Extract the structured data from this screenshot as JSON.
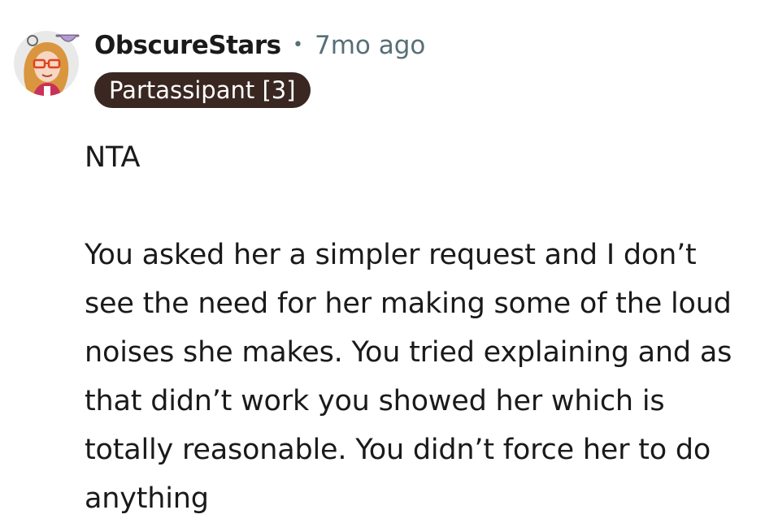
{
  "comment": {
    "avatar_icon": "user-avatar-icon",
    "username": "ObscureStars",
    "separator": "•",
    "timestamp": "7mo ago",
    "flair": "Partassipant [3]",
    "paragraphs": [
      "NTA",
      "You asked her a simpler request and I don’t see the need for her making some of the loud noises she makes. You tried explaining and as that didn’t work you showed her which is totally reasonable. You didn’t force her to do anything"
    ]
  },
  "colors": {
    "flair_background": "#3a2722",
    "meta_text": "#576f76",
    "body_text": "#1a1a1b"
  }
}
